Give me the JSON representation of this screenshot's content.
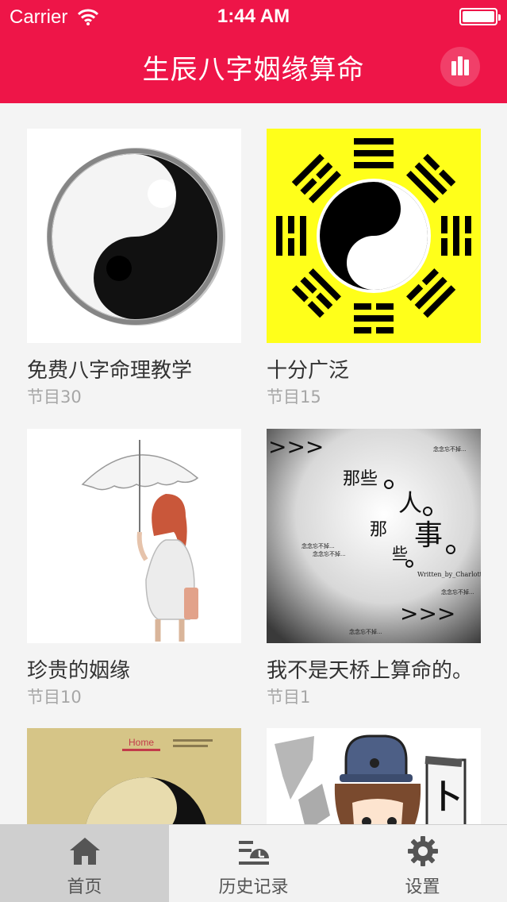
{
  "status_bar": {
    "carrier": "Carrier",
    "time": "1:44 AM",
    "battery_level": 1.0
  },
  "nav": {
    "title": "生辰八字姻缘算命",
    "right_icon": "bar-stats-icon"
  },
  "colors": {
    "nav_background": "#ee1548",
    "tab_active_background": "#cfcfcf",
    "tab_icon": "#555555"
  },
  "programs": [
    {
      "title": "免费八字命理教学",
      "count": "节目30",
      "image": "ink-yin-yang"
    },
    {
      "title": "十分广泛",
      "count": "节目15",
      "image": "bagua-yin-yang-yellow"
    },
    {
      "title": "珍贵的姻缘",
      "count": "节目10",
      "image": "girl-with-umbrella"
    },
    {
      "title": "我不是天桥上算命的。",
      "count": "节目1",
      "image": "那些人那些事-graphic",
      "image_text": {
        "arrows": ">>>",
        "word_a": "那些",
        "word_b": "人",
        "word_c": "那",
        "word_d": "事",
        "word_e": "些",
        "small": "念念忘不掉...",
        "credit": "Written_by_Charlotte"
      }
    },
    {
      "title": "",
      "count": "",
      "image": "yin-yang-poster",
      "image_text": {
        "brand": "Home"
      }
    },
    {
      "title": "",
      "count": "",
      "image": "cartoon-fortune-teller",
      "image_text": {
        "sign": "卜"
      }
    }
  ],
  "tabs": [
    {
      "label": "首页",
      "icon": "home-icon",
      "active": true
    },
    {
      "label": "历史记录",
      "icon": "history-icon",
      "active": false
    },
    {
      "label": "设置",
      "icon": "gear-icon",
      "active": false
    }
  ]
}
